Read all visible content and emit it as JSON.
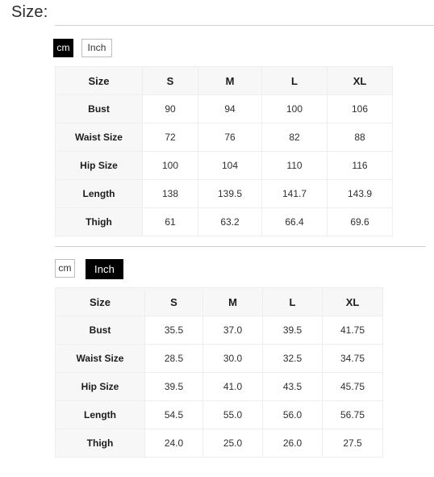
{
  "page": {
    "title": "Size:"
  },
  "sections": [
    {
      "unit_toggle": {
        "cm_label": "cm",
        "inch_label": "Inch",
        "active": "cm"
      },
      "table": {
        "headers": [
          "Size",
          "S",
          "M",
          "L",
          "XL"
        ],
        "rows": [
          {
            "label": "Bust",
            "values": [
              "90",
              "94",
              "100",
              "106"
            ]
          },
          {
            "label": "Waist Size",
            "values": [
              "72",
              "76",
              "82",
              "88"
            ]
          },
          {
            "label": "Hip Size",
            "values": [
              "100",
              "104",
              "110",
              "116"
            ]
          },
          {
            "label": "Length",
            "values": [
              "138",
              "139.5",
              "141.7",
              "143.9"
            ]
          },
          {
            "label": "Thigh",
            "values": [
              "61",
              "63.2",
              "66.4",
              "69.6"
            ]
          }
        ]
      }
    },
    {
      "unit_toggle": {
        "cm_label": "cm",
        "inch_label": "Inch",
        "active": "Inch"
      },
      "table": {
        "headers": [
          "Size",
          "S",
          "M",
          "L",
          "XL"
        ],
        "rows": [
          {
            "label": "Bust",
            "values": [
              "35.5",
              "37.0",
              "39.5",
              "41.75"
            ]
          },
          {
            "label": "Waist Size",
            "values": [
              "28.5",
              "30.0",
              "32.5",
              "34.75"
            ]
          },
          {
            "label": "Hip Size",
            "values": [
              "39.5",
              "41.0",
              "43.5",
              "45.75"
            ]
          },
          {
            "label": "Length",
            "values": [
              "54.5",
              "55.0",
              "56.0",
              "56.75"
            ]
          },
          {
            "label": "Thigh",
            "values": [
              "24.0",
              "25.0",
              "26.0",
              "27.5"
            ]
          }
        ]
      }
    }
  ],
  "colors": {
    "active_toggle_bg": "#000000",
    "active_toggle_text": "#ffffff",
    "inactive_toggle_border": "#bdbdbd",
    "header_bg": "#f7f7f7",
    "cell_border": "#eeeeee",
    "divider": "#cfcfcf"
  }
}
